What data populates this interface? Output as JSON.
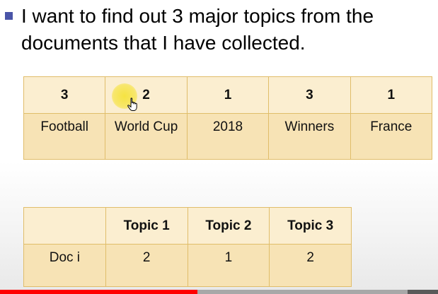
{
  "slide": {
    "bullet_text": "I want to find out 3 major topics from the\ndocuments that I have collected.",
    "bullet_color": "#4a55a8"
  },
  "word_table": {
    "counts": [
      "3",
      "2",
      "1",
      "3",
      "1"
    ],
    "words": [
      "Football",
      "World Cup",
      "2018",
      "Winners",
      "France"
    ],
    "cell_color": "#f7e3b5",
    "border_color": "#e0bd6a"
  },
  "topic_table": {
    "headers": [
      "",
      "Topic 1",
      "Topic 2",
      "Topic 3"
    ],
    "row_label": "Doc i",
    "row_values": [
      "2",
      "1",
      "2"
    ]
  },
  "video_progress": {
    "played_fraction": 0.45,
    "buffered_fraction": 0.93,
    "played_color": "#ff0000"
  },
  "cursor": {
    "icon": "hand-pointer-icon",
    "highlight_color": "#f5e128"
  }
}
